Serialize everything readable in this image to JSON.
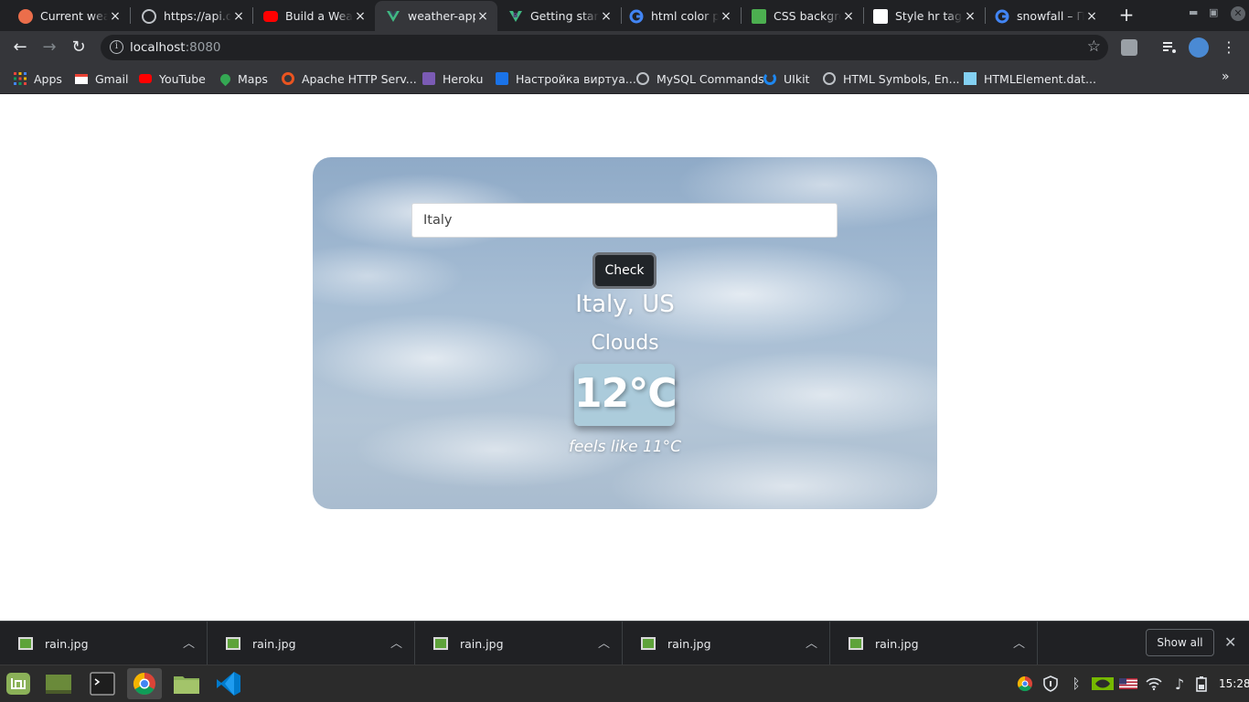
{
  "browser": {
    "tabs": [
      {
        "title": "Current weather",
        "icon": "openweather-icon",
        "color": "#eb6e4b"
      },
      {
        "title": "https://api.openweathermap.org",
        "icon": "globe-icon",
        "color": "#bdc1c6"
      },
      {
        "title": "Build a Weather App",
        "icon": "youtube-icon",
        "color": "#ff0000"
      },
      {
        "title": "weather-app",
        "icon": "vue-icon",
        "color": "#41b883"
      },
      {
        "title": "Getting started",
        "icon": "bootstrap-vue-icon",
        "color": "#41b883"
      },
      {
        "title": "html color picker",
        "icon": "google-icon",
        "color": "#4285f4"
      },
      {
        "title": "CSS background",
        "icon": "w3schools-icon",
        "color": "#4caf50"
      },
      {
        "title": "Style hr tag",
        "icon": "codepen-icon",
        "color": "#ffffff"
      },
      {
        "title": "snowfall – Поиск",
        "icon": "google-icon",
        "color": "#4285f4"
      }
    ],
    "active_tab": 3,
    "new_tab_label": "+",
    "close_glyph": "×",
    "url_host": "localhost",
    "url_port": ":8080",
    "bookmarks": [
      {
        "label": "Apps",
        "icon": "apps-grid-icon",
        "color": "#e8453c"
      },
      {
        "label": "Gmail",
        "icon": "gmail-icon",
        "color": "#ea4335"
      },
      {
        "label": "YouTube",
        "icon": "youtube-icon",
        "color": "#ff0000"
      },
      {
        "label": "Maps",
        "icon": "maps-pin-icon",
        "color": "#34a853"
      },
      {
        "label": "Apache HTTP Serv...",
        "icon": "ubuntu-icon",
        "color": "#e95420"
      },
      {
        "label": "Heroku",
        "icon": "heroku-icon",
        "color": "#7b5bb5"
      },
      {
        "label": "Настройка виртуа...",
        "icon": "bookmark-site-icon",
        "color": "#1a73e8"
      },
      {
        "label": "MySQL Commands",
        "icon": "globe-icon",
        "color": "#bdc1c6"
      },
      {
        "label": "UIkit",
        "icon": "uikit-icon",
        "color": "#1e87f0"
      },
      {
        "label": "HTML Symbols, En...",
        "icon": "globe-icon",
        "color": "#bdc1c6"
      },
      {
        "label": "HTMLElement.dat...",
        "icon": "mdn-icon",
        "color": "#83d0f2"
      }
    ]
  },
  "weather": {
    "search_value": "Italy",
    "check_label": "Check",
    "city": "Italy, US",
    "condition": "Clouds",
    "temperature": "12°C",
    "feels_like": "feels like 11°C"
  },
  "downloads": {
    "items": [
      "rain.jpg",
      "rain.jpg",
      "rain.jpg",
      "rain.jpg",
      "rain.jpg"
    ],
    "show_all_label": "Show all"
  },
  "taskbar": {
    "clock": "15:28",
    "apps": [
      "mint-menu-icon",
      "show-desktop-icon",
      "terminal-icon",
      "chrome-icon",
      "files-icon",
      "vscode-icon"
    ]
  }
}
